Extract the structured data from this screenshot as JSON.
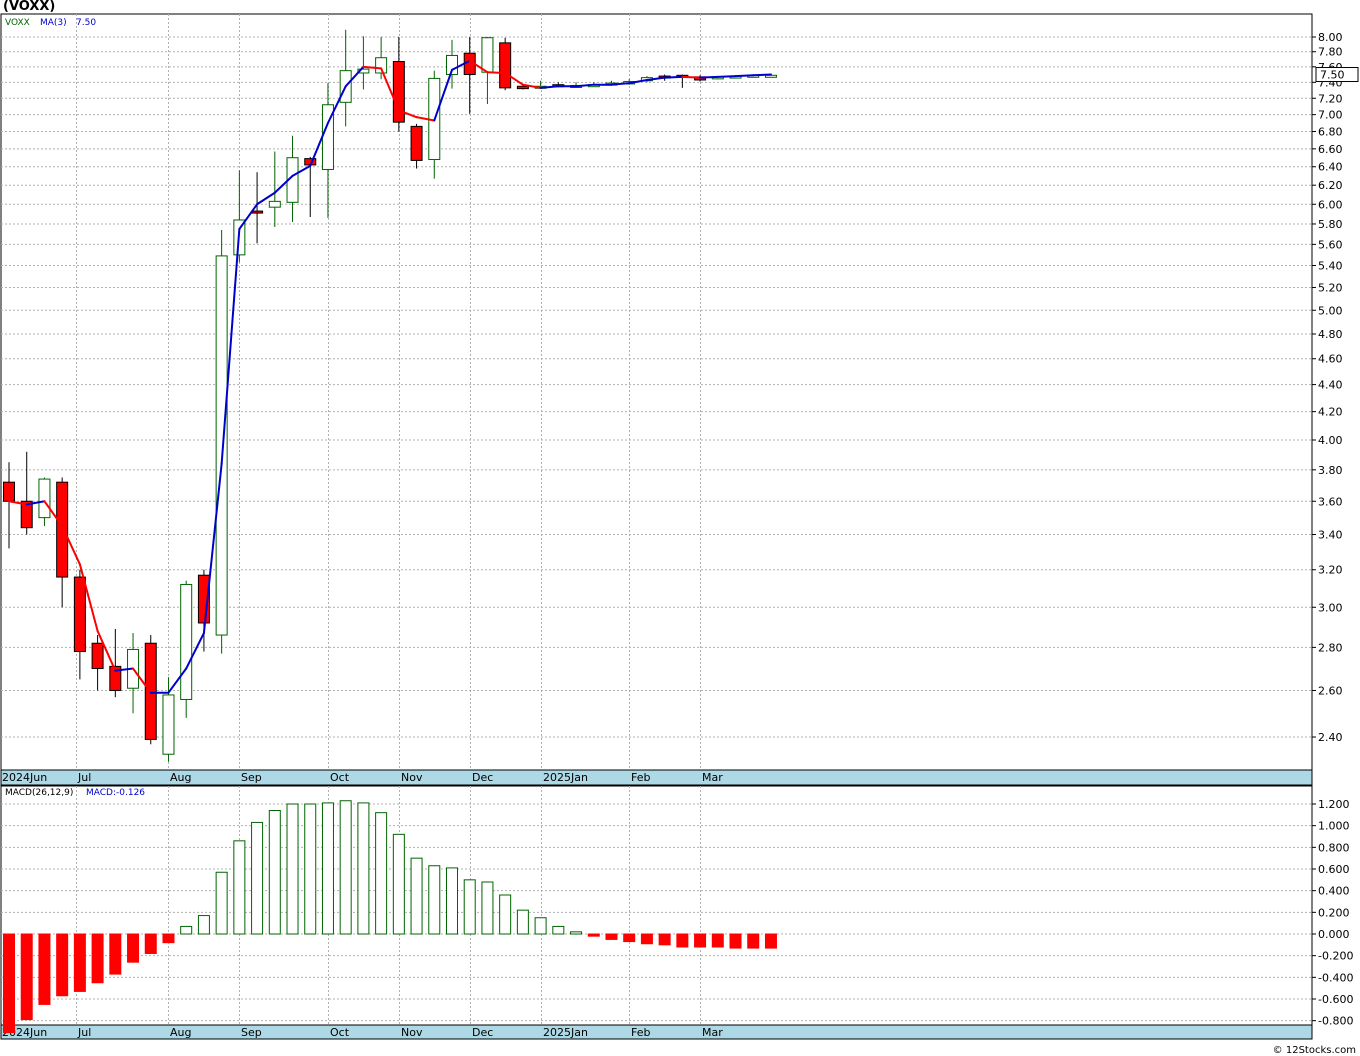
{
  "title": "(VOXX)",
  "credit": "© 12Stocks.com",
  "price_panel": {
    "legend": {
      "symbol": "VOXX",
      "ma_label": "MA(3)",
      "ma_value": "7.50"
    },
    "last_price_badge": "7.50",
    "y_ticks": [
      "2.40",
      "2.60",
      "2.80",
      "3.00",
      "3.20",
      "3.40",
      "3.60",
      "3.80",
      "4.00",
      "4.20",
      "4.40",
      "4.60",
      "4.80",
      "5.00",
      "5.20",
      "5.40",
      "5.60",
      "5.80",
      "6.00",
      "6.20",
      "6.40",
      "6.60",
      "6.80",
      "7.00",
      "7.20",
      "7.40",
      "7.60",
      "7.80",
      "8.00"
    ]
  },
  "macd_panel": {
    "legend": {
      "label": "MACD(26,12,9)",
      "value_label": "MACD:-0.126"
    },
    "y_ticks": [
      "-0.800",
      "-0.600",
      "-0.400",
      "-0.200",
      "0.000",
      "0.200",
      "0.400",
      "0.600",
      "0.800",
      "1.000",
      "1.200"
    ]
  },
  "x_axis": {
    "months": [
      {
        "label": "2024Jun",
        "week": 0
      },
      {
        "label": "Jul",
        "week": 4.3
      },
      {
        "label": "Aug",
        "week": 9.5
      },
      {
        "label": "Sep",
        "week": 13.5
      },
      {
        "label": "Oct",
        "week": 18.5
      },
      {
        "label": "Nov",
        "week": 22.5
      },
      {
        "label": "Dec",
        "week": 26.5
      },
      {
        "label": "2025Jan",
        "week": 30.5
      },
      {
        "label": "Feb",
        "week": 35.5
      },
      {
        "label": "Mar",
        "week": 39.5
      }
    ]
  },
  "colors": {
    "up": "#006400",
    "down": "#ff0000",
    "ma_up": "#0000cc",
    "ma_down": "#ff0000",
    "grid": "#b0b0b0",
    "axis_strip": "#add8e6"
  },
  "chart_data": [
    {
      "type": "candlestick",
      "ticker": "VOXX",
      "period": "weekly",
      "y_scale": "log",
      "ylim": [
        2.28,
        8.15
      ],
      "candles": [
        {
          "o": 3.72,
          "h": 3.85,
          "l": 3.32,
          "c": 3.6
        },
        {
          "o": 3.6,
          "h": 3.92,
          "l": 3.4,
          "c": 3.44
        },
        {
          "o": 3.5,
          "h": 3.75,
          "l": 3.45,
          "c": 3.74
        },
        {
          "o": 3.72,
          "h": 3.75,
          "l": 3.0,
          "c": 3.16
        },
        {
          "o": 3.16,
          "h": 3.2,
          "l": 2.65,
          "c": 2.78
        },
        {
          "o": 2.82,
          "h": 2.86,
          "l": 2.6,
          "c": 2.7
        },
        {
          "o": 2.71,
          "h": 2.89,
          "l": 2.57,
          "c": 2.6
        },
        {
          "o": 2.61,
          "h": 2.87,
          "l": 2.5,
          "c": 2.79
        },
        {
          "o": 2.82,
          "h": 2.86,
          "l": 2.37,
          "c": 2.39
        },
        {
          "o": 2.33,
          "h": 2.66,
          "l": 2.3,
          "c": 2.58
        },
        {
          "o": 2.56,
          "h": 3.14,
          "l": 2.48,
          "c": 3.12
        },
        {
          "o": 3.17,
          "h": 3.2,
          "l": 2.78,
          "c": 2.92
        },
        {
          "o": 2.86,
          "h": 5.74,
          "l": 2.77,
          "c": 5.49
        },
        {
          "o": 5.5,
          "h": 6.36,
          "l": 5.43,
          "c": 5.84
        },
        {
          "o": 5.93,
          "h": 6.34,
          "l": 5.61,
          "c": 5.91
        },
        {
          "o": 5.97,
          "h": 6.57,
          "l": 5.77,
          "c": 6.03
        },
        {
          "o": 6.02,
          "h": 6.75,
          "l": 5.82,
          "c": 6.5
        },
        {
          "o": 6.49,
          "h": 6.51,
          "l": 5.87,
          "c": 6.42
        },
        {
          "o": 6.37,
          "h": 7.39,
          "l": 5.86,
          "c": 7.12
        },
        {
          "o": 7.15,
          "h": 8.1,
          "l": 6.86,
          "c": 7.55
        },
        {
          "o": 7.52,
          "h": 8.01,
          "l": 7.31,
          "c": 7.57
        },
        {
          "o": 7.52,
          "h": 8.0,
          "l": 7.44,
          "c": 7.72
        },
        {
          "o": 7.67,
          "h": 8.0,
          "l": 6.8,
          "c": 6.91
        },
        {
          "o": 6.86,
          "h": 6.89,
          "l": 6.38,
          "c": 6.47
        },
        {
          "o": 6.48,
          "h": 7.55,
          "l": 6.27,
          "c": 7.45
        },
        {
          "o": 7.5,
          "h": 7.96,
          "l": 7.32,
          "c": 7.75
        },
        {
          "o": 7.78,
          "h": 8.0,
          "l": 7.01,
          "c": 7.5
        },
        {
          "o": 7.53,
          "h": 8.0,
          "l": 7.13,
          "c": 7.99
        },
        {
          "o": 7.92,
          "h": 7.99,
          "l": 7.3,
          "c": 7.33
        },
        {
          "o": 7.35,
          "h": 7.38,
          "l": 7.31,
          "c": 7.32
        },
        {
          "o": 7.33,
          "h": 7.42,
          "l": 7.32,
          "c": 7.35
        },
        {
          "o": 7.37,
          "h": 7.4,
          "l": 7.34,
          "c": 7.35
        },
        {
          "o": 7.35,
          "h": 7.4,
          "l": 7.34,
          "c": 7.36
        },
        {
          "o": 7.36,
          "h": 7.4,
          "l": 7.35,
          "c": 7.37
        },
        {
          "o": 7.37,
          "h": 7.42,
          "l": 7.36,
          "c": 7.39
        },
        {
          "o": 7.38,
          "h": 7.44,
          "l": 7.37,
          "c": 7.41
        },
        {
          "o": 7.42,
          "h": 7.48,
          "l": 7.4,
          "c": 7.46
        },
        {
          "o": 7.48,
          "h": 7.5,
          "l": 7.42,
          "c": 7.47
        },
        {
          "o": 7.49,
          "h": 7.5,
          "l": 7.33,
          "c": 7.47
        },
        {
          "o": 7.47,
          "h": 7.49,
          "l": 7.41,
          "c": 7.43
        },
        {
          "o": 7.46,
          "h": 7.48,
          "l": 7.44,
          "c": 7.47
        },
        {
          "o": 7.47,
          "h": 7.49,
          "l": 7.46,
          "c": 7.48
        },
        {
          "o": 7.48,
          "h": 7.5,
          "l": 7.47,
          "c": 7.49
        },
        {
          "o": 7.49,
          "h": 7.5,
          "l": 7.48,
          "c": 7.49
        }
      ],
      "ma3": [
        3.6,
        3.58,
        3.6,
        3.45,
        3.23,
        2.88,
        2.69,
        2.7,
        2.59,
        2.59,
        2.7,
        2.87,
        3.84,
        5.75,
        6.0,
        6.12,
        6.3,
        6.41,
        6.9,
        7.35,
        7.6,
        7.58,
        7.05,
        6.97,
        6.93,
        7.56,
        7.68,
        7.53,
        7.52,
        7.37,
        7.33,
        7.35,
        7.35,
        7.37,
        7.37,
        7.39,
        7.43,
        7.46,
        7.47,
        7.46,
        7.47,
        7.48,
        7.49,
        7.5
      ]
    },
    {
      "type": "bar",
      "name": "MACD(26,12,9)",
      "ylim": [
        -0.85,
        1.3
      ],
      "values": [
        -0.91,
        -0.79,
        -0.65,
        -0.57,
        -0.53,
        -0.45,
        -0.37,
        -0.26,
        -0.18,
        -0.08,
        0.07,
        0.17,
        0.57,
        0.86,
        1.03,
        1.14,
        1.2,
        1.2,
        1.21,
        1.23,
        1.21,
        1.12,
        0.92,
        0.7,
        0.63,
        0.61,
        0.5,
        0.48,
        0.36,
        0.22,
        0.15,
        0.07,
        0.02,
        -0.02,
        -0.05,
        -0.07,
        -0.09,
        -0.1,
        -0.12,
        -0.12,
        -0.12,
        -0.13,
        -0.13,
        -0.13
      ]
    }
  ]
}
